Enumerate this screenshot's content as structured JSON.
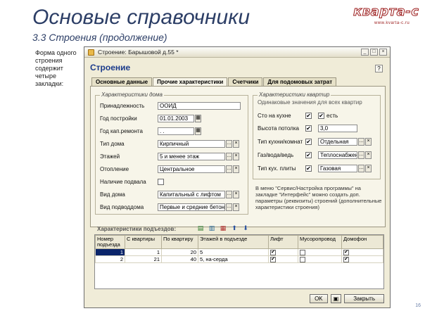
{
  "slide": {
    "title": "Основые справочники",
    "subtitle": "3.3  Строения (продолжение)",
    "side_note": "Форма одного строения содержит четыре закладки:",
    "logo_main": "кварта-с",
    "logo_site": "www.kvarta-c.ru",
    "page_number": "16"
  },
  "window": {
    "title": "Строение: Барышовой д.55 *",
    "form_header": "Строение",
    "tabs": [
      "Основные данные",
      "Прочие характеристики",
      "Счетчики",
      "Для подомовых затрат"
    ],
    "left_group_title": "Характеристики дома",
    "right_group_title": "Характеристики квартир",
    "right_group_note": "Одинаковые значения для всех квартир",
    "left_rows": [
      {
        "label": "Принадлежность",
        "value": "ООИД"
      },
      {
        "label": "Год постройки",
        "value": "01.01.2003"
      },
      {
        "label": "Год кап.ремонта",
        "value": " .  ."
      },
      {
        "label": "Тип дома",
        "value": "Кирпичный"
      },
      {
        "label": "Этажей",
        "value": "5 и менее этаж"
      },
      {
        "label": "Отопление",
        "value": "Центральное"
      },
      {
        "label": "Наличие подвала",
        "value": ""
      },
      {
        "label": "Вид дома",
        "value": "Капитальный с лифтом"
      },
      {
        "label": "Вид подводдома",
        "value": "Первые и средние бетон"
      }
    ],
    "right_rows": [
      {
        "label": "Сто на кухне",
        "extra_label": "есть"
      },
      {
        "label": "Высота потолка",
        "value": "3,0"
      },
      {
        "label": "Тип кухни/комнат",
        "value": "Отдельная"
      },
      {
        "label": "Газ/вода/ведь",
        "value": "Теплоснабжение"
      },
      {
        "label": "Тип кух. плиты",
        "value": "Газовая"
      }
    ],
    "info_text": "В меню \"Сервис/Настройка программы\" на закладке \"Интерфейс\" можно создать доп. параметры (реквизиты) строений (дополнительные характеристики строения)",
    "table_title": "Характеристики подъездов:",
    "table_headers": [
      "Номер подъезда",
      "С квартиры",
      "По квартиру",
      "Этажей в подъезде",
      "Лифт",
      "Мусоропровод",
      "Домофон"
    ],
    "table_rows": [
      {
        "n": "1",
        "from": "1",
        "to": "20",
        "floors": "5",
        "lift": "✔",
        "trash": "",
        "intercom": "✔"
      },
      {
        "n": "2",
        "from": "21",
        "to": "40",
        "floors": "5, на-серда",
        "lift": "✔",
        "trash": "",
        "intercom": "✔"
      }
    ],
    "ok_label": "OK",
    "close_label": "Закрыть"
  }
}
